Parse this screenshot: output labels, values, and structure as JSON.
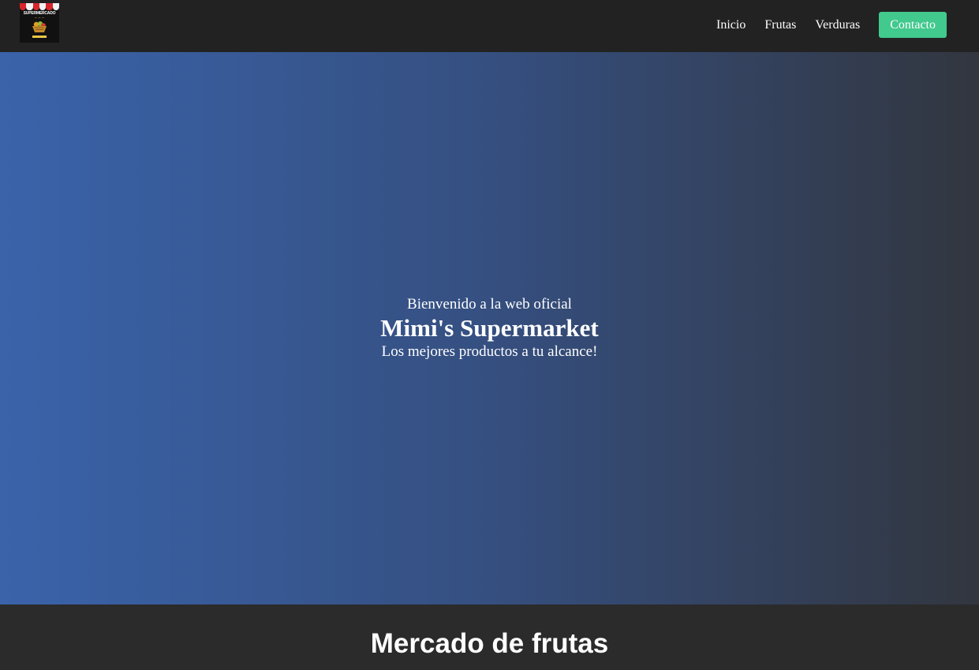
{
  "navbar": {
    "logo": {
      "brand": "SUPERMERCADO",
      "colors": {
        "awning_red": "#d8262b",
        "awning_white": "#f4f4f4",
        "accent": "#e8c649"
      }
    },
    "links": [
      {
        "label": "Inicio"
      },
      {
        "label": "Frutas"
      },
      {
        "label": "Verduras"
      }
    ],
    "cta": {
      "label": "Contacto",
      "color": "#41c98e"
    },
    "background": "#222222"
  },
  "hero": {
    "welcome": "Bienvenido a la web oficial",
    "title": "Mimi's Supermarket",
    "tagline": "Los mejores productos a tu alcance!",
    "gradient": [
      "#3a63aa",
      "#354f80",
      "#32363f"
    ]
  },
  "section": {
    "title": "Mercado de frutas",
    "background": "#2b2b2b"
  }
}
